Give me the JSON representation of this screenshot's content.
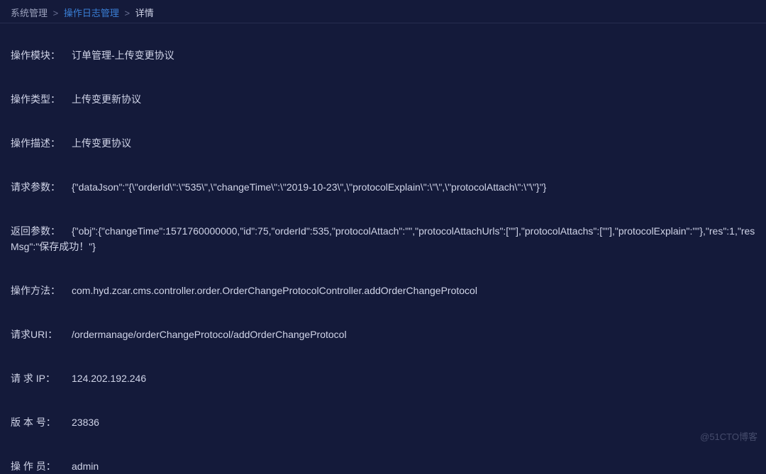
{
  "breadcrumb": {
    "root": "系统管理",
    "mid": "操作日志管理",
    "current": "详情",
    "sep": ">"
  },
  "rows": {
    "module": {
      "label": "操作模块：",
      "value": "订单管理-上传变更协议"
    },
    "type": {
      "label": "操作类型：",
      "value": "上传变更新协议"
    },
    "desc": {
      "label": "操作描述：",
      "value": "上传变更协议"
    },
    "req": {
      "label": "请求参数：",
      "value": "{\"dataJson\":\"{\\\"orderId\\\":\\\"535\\\",\\\"changeTime\\\":\\\"2019-10-23\\\",\\\"protocolExplain\\\":\\\"\\\",\\\"protocolAttach\\\":\\\"\\\"}\"}"
    },
    "resp": {
      "label": "返回参数：",
      "value": "{\"obj\":{\"changeTime\":1571760000000,\"id\":75,\"orderId\":535,\"protocolAttach\":\"\",\"protocolAttachUrls\":[\"\"],\"protocolAttachs\":[\"\"],\"protocolExplain\":\"\"},\"res\":1,\"resMsg\":\"保存成功！\"}"
    },
    "method": {
      "label": "操作方法：",
      "value": "com.hyd.zcar.cms.controller.order.OrderChangeProtocolController.addOrderChangeProtocol"
    },
    "uri": {
      "label": "请求URI：",
      "value": "/ordermanage/orderChangeProtocol/addOrderChangeProtocol"
    },
    "ip": {
      "label": "请 求 IP：",
      "value": "124.202.192.246"
    },
    "ver": {
      "label": "版 本 号：",
      "value": "23836"
    },
    "oper": {
      "label": "操 作 员：",
      "value": "admin"
    }
  },
  "watermark": "@51CTO博客"
}
